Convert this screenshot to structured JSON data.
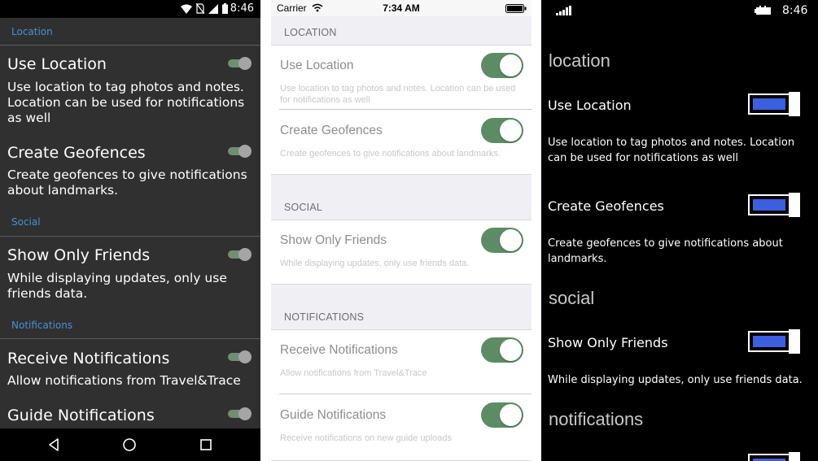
{
  "colors": {
    "android_accent": "#4a8fd6",
    "android_switch_track": "#6f8f73",
    "ios_switch_on": "#5c8c63",
    "winphone_toggle_fill": "#3a5fe0"
  },
  "android": {
    "status_time": "8:46",
    "status_icons": [
      "wifi-icon",
      "no-sim-icon",
      "signal-icon",
      "battery-icon"
    ],
    "sections": [
      {
        "label": "Location"
      },
      {
        "label": "Social"
      },
      {
        "label": "Notifications"
      }
    ],
    "settings": [
      {
        "title": "Use Location",
        "description": "Use location to tag photos and notes. Location can be used for notifications as well",
        "enabled": true
      },
      {
        "title": "Create Geofences",
        "description": "Create geofences to give notifications about landmarks.",
        "enabled": true
      },
      {
        "title": "Show Only Friends",
        "description": "While displaying updates, only use friends data.",
        "enabled": true
      },
      {
        "title": "Receive Notifications",
        "description": "Allow notifications from Travel&Trace",
        "enabled": true
      },
      {
        "title": "Guide Notifications",
        "description": "",
        "enabled": true
      }
    ],
    "nav_icons": [
      "back-icon",
      "home-icon",
      "recents-icon"
    ]
  },
  "ios": {
    "carrier": "Carrier",
    "status_time": "7:34 AM",
    "status_icons": [
      "wifi-icon",
      "battery-icon"
    ],
    "sections": [
      {
        "label": "LOCATION"
      },
      {
        "label": "SOCIAL"
      },
      {
        "label": "NOTIFICATIONS"
      }
    ],
    "settings": [
      {
        "title": "Use Location",
        "description": "Use location to tag photos and notes. Location can be used for notifications as well",
        "enabled": true
      },
      {
        "title": "Create Geofences",
        "description": "Create geofences to give notifications about landmarks.",
        "enabled": true
      },
      {
        "title": "Show Only Friends",
        "description": "While displaying updates, only use friends data.",
        "enabled": true
      },
      {
        "title": "Receive Notifications",
        "description": "Allow notifications from Travel&Trace",
        "enabled": true
      },
      {
        "title": "Guide Notifications",
        "description": "Receive notifications on new guide uploads",
        "enabled": true
      }
    ]
  },
  "winphone": {
    "status_time": "8:46",
    "status_icons": [
      "signal-icon",
      "battery-icon"
    ],
    "sections": [
      {
        "label": "location"
      },
      {
        "label": "social"
      },
      {
        "label": "notifications"
      }
    ],
    "settings": [
      {
        "title": "Use Location",
        "description": "Use location to tag photos and notes. Location can be used for notifications as well",
        "enabled": true
      },
      {
        "title": "Create Geofences",
        "description": "Create geofences to give notifications about landmarks.",
        "enabled": true
      },
      {
        "title": "Show Only Friends",
        "description": "While displaying updates, only use friends data.",
        "enabled": true
      }
    ]
  }
}
